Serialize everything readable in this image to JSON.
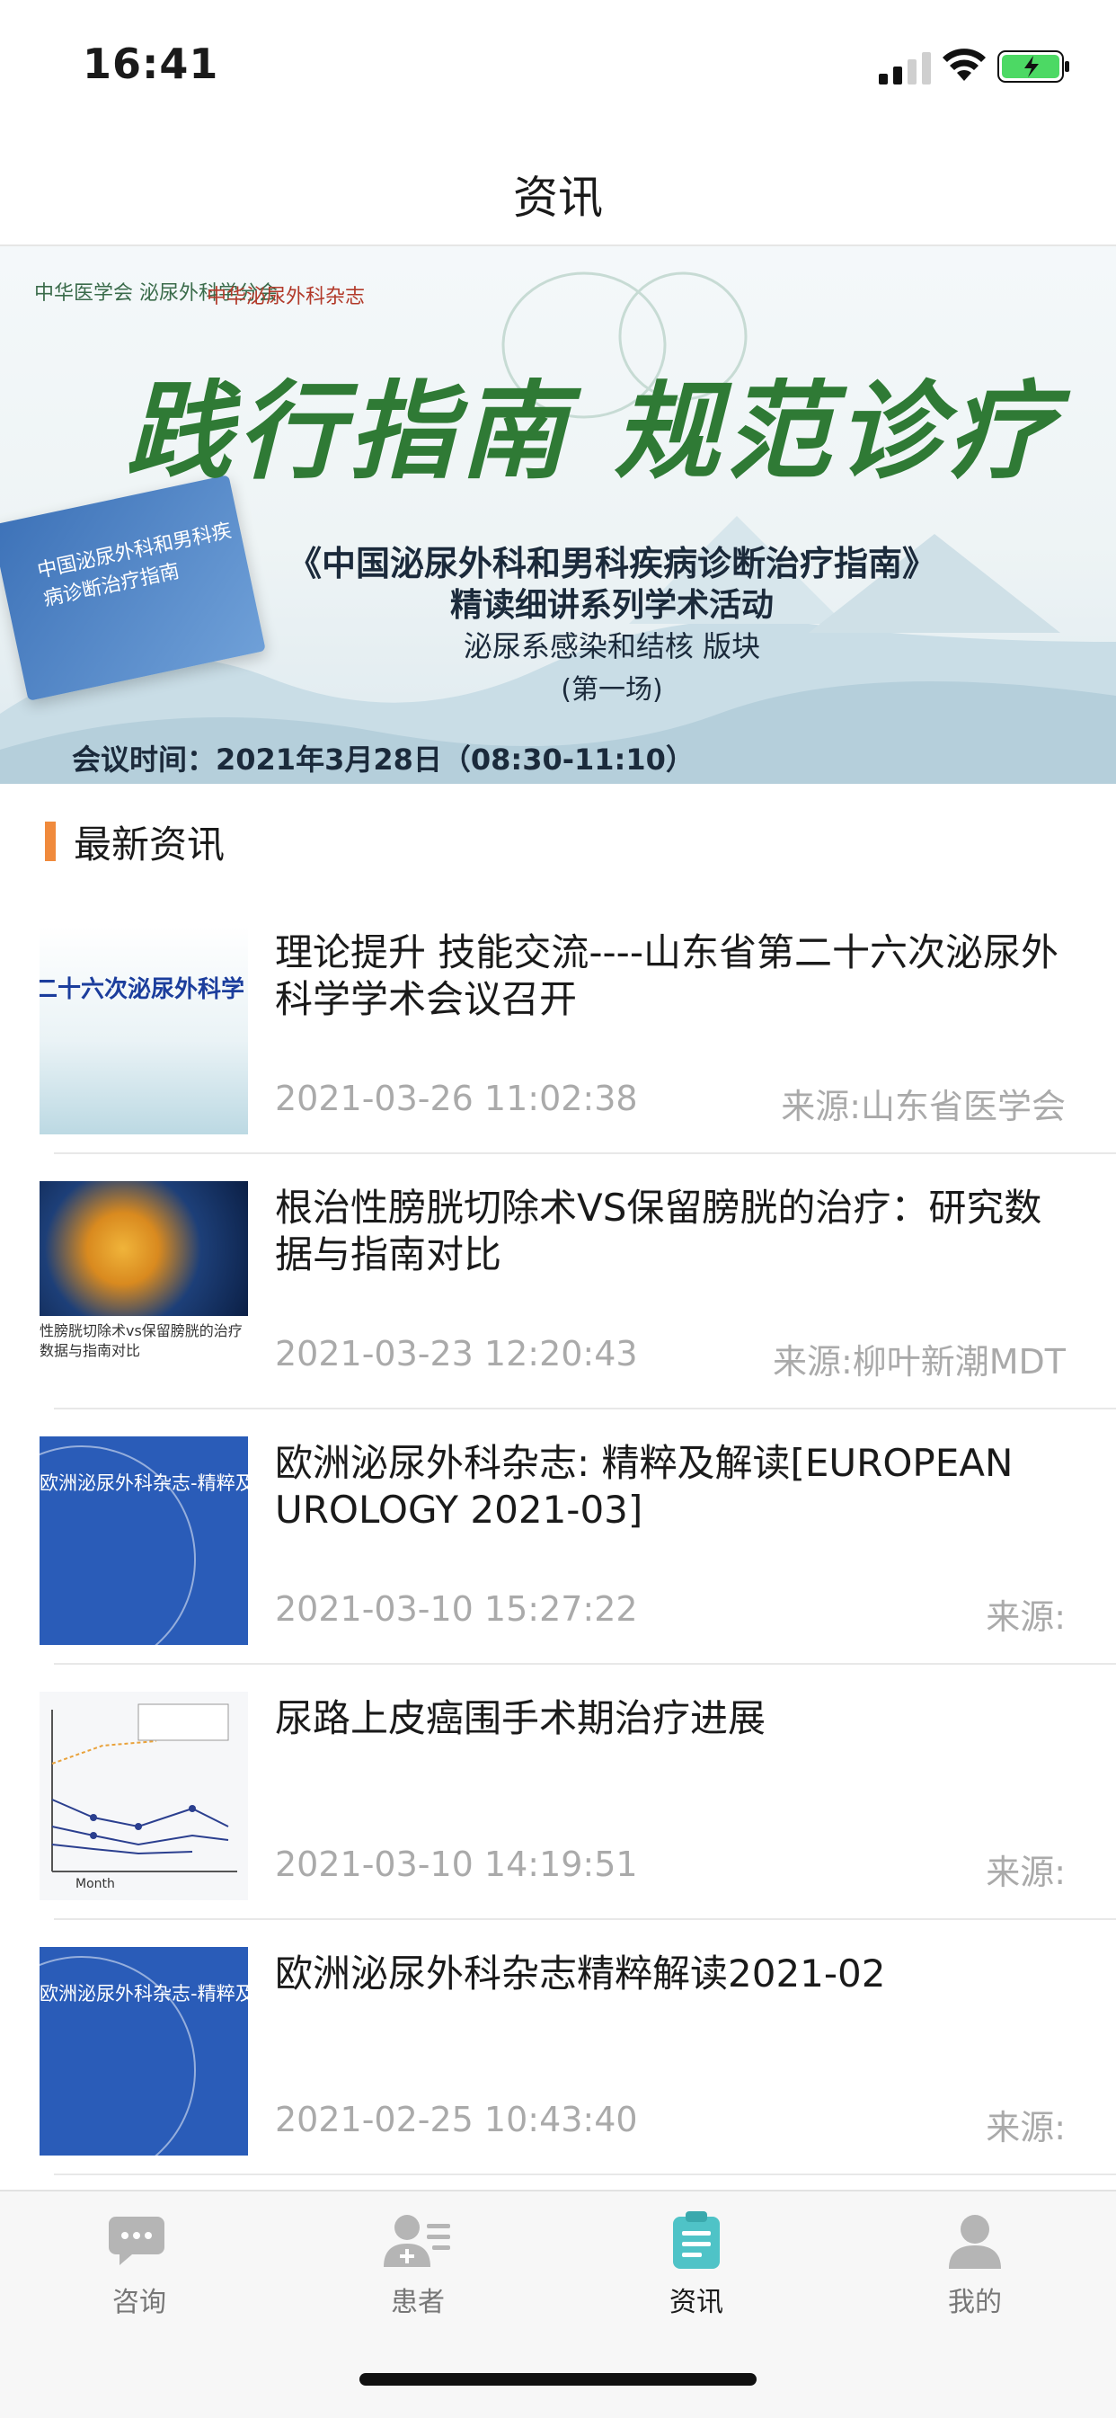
{
  "status_bar": {
    "time": "16:41"
  },
  "nav": {
    "title": "资讯"
  },
  "banner": {
    "org": "中华医学会 泌尿外科学分会",
    "magazine": "中华泌尿外科杂志",
    "title": "践行指南 规范诊疗",
    "subtitle1": "《中国泌尿外科和男科疾病诊断治疗指南》",
    "subtitle2": "精读细讲系列学术活动",
    "subtitle3": "泌尿系感染和结核 版块",
    "subtitle4": "(第一场)",
    "meeting_time": "会议时间：2021年3月28日（08:30-11:10）",
    "book_text": "中国泌尿外科和男科疾病诊断治疗指南"
  },
  "section": {
    "title": "最新资讯"
  },
  "news": [
    {
      "title": "理论提升 技能交流----山东省第二十六次泌尿外科学学术会议召开",
      "date": "2021-03-26 11:02:38",
      "source": "来源:山东省医学会",
      "thumb_text": "二十六次泌尿外科学"
    },
    {
      "title": "根治性膀胱切除术VS保留膀胱的治疗：研究数据与指南对比",
      "date": "2021-03-23 12:20:43",
      "source": "来源:柳叶新潮MDT",
      "thumb_text": "性膀胱切除术vs保留膀胱的治疗 数据与指南对比"
    },
    {
      "title": "欧洲泌尿外科杂志: 精粹及解读[EUROPEAN UROLOGY 2021-03]",
      "date": "2021-03-10 15:27:22",
      "source": "来源:",
      "thumb_text": "欧洲泌尿外科杂志-精粹及解读"
    },
    {
      "title": "尿路上皮癌围手术期治疗进展",
      "date": "2021-03-10 14:19:51",
      "source": "来源:",
      "thumb_text": "Month"
    },
    {
      "title": "欧洲泌尿外科杂志精粹解读2021-02",
      "date": "2021-02-25 10:43:40",
      "source": "来源:",
      "thumb_text": "欧洲泌尿外科杂志-精粹及解读"
    }
  ],
  "tabs": [
    {
      "label": "咨询",
      "icon": "chat-icon",
      "active": false
    },
    {
      "label": "患者",
      "icon": "patients-icon",
      "active": false
    },
    {
      "label": "资讯",
      "icon": "news-icon",
      "active": true
    },
    {
      "label": "我的",
      "icon": "profile-icon",
      "active": false
    }
  ],
  "colors": {
    "accent": "#f08a3c",
    "active_tab": "#4fc3c7",
    "inactive_tab": "#b5b5b5"
  }
}
